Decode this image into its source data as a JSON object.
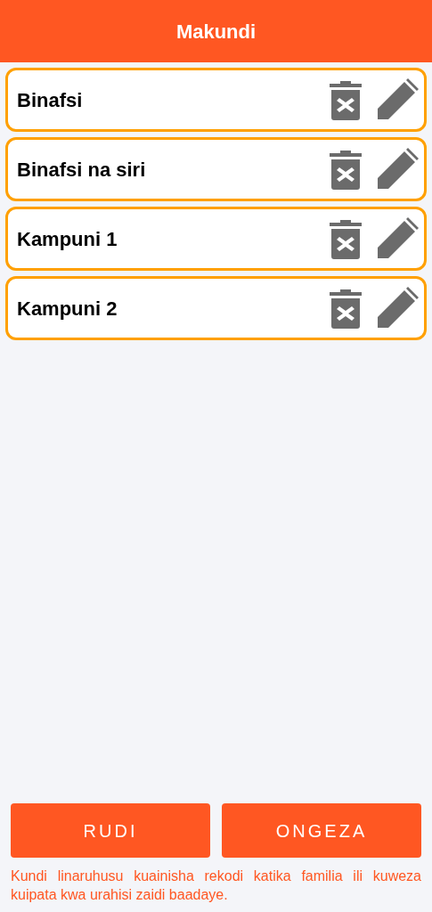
{
  "header": {
    "title": "Makundi"
  },
  "groups": [
    {
      "name": "Binafsi"
    },
    {
      "name": "Binafsi na siri"
    },
    {
      "name": "Kampuni 1"
    },
    {
      "name": "Kampuni 2"
    }
  ],
  "buttons": [
    "RUDI",
    "ONGEZA"
  ],
  "note": "Kundi linaruhusu kuainisha rekodi katika familia ili kuweza kuipata kwa urahisi zaidi baadaye."
}
